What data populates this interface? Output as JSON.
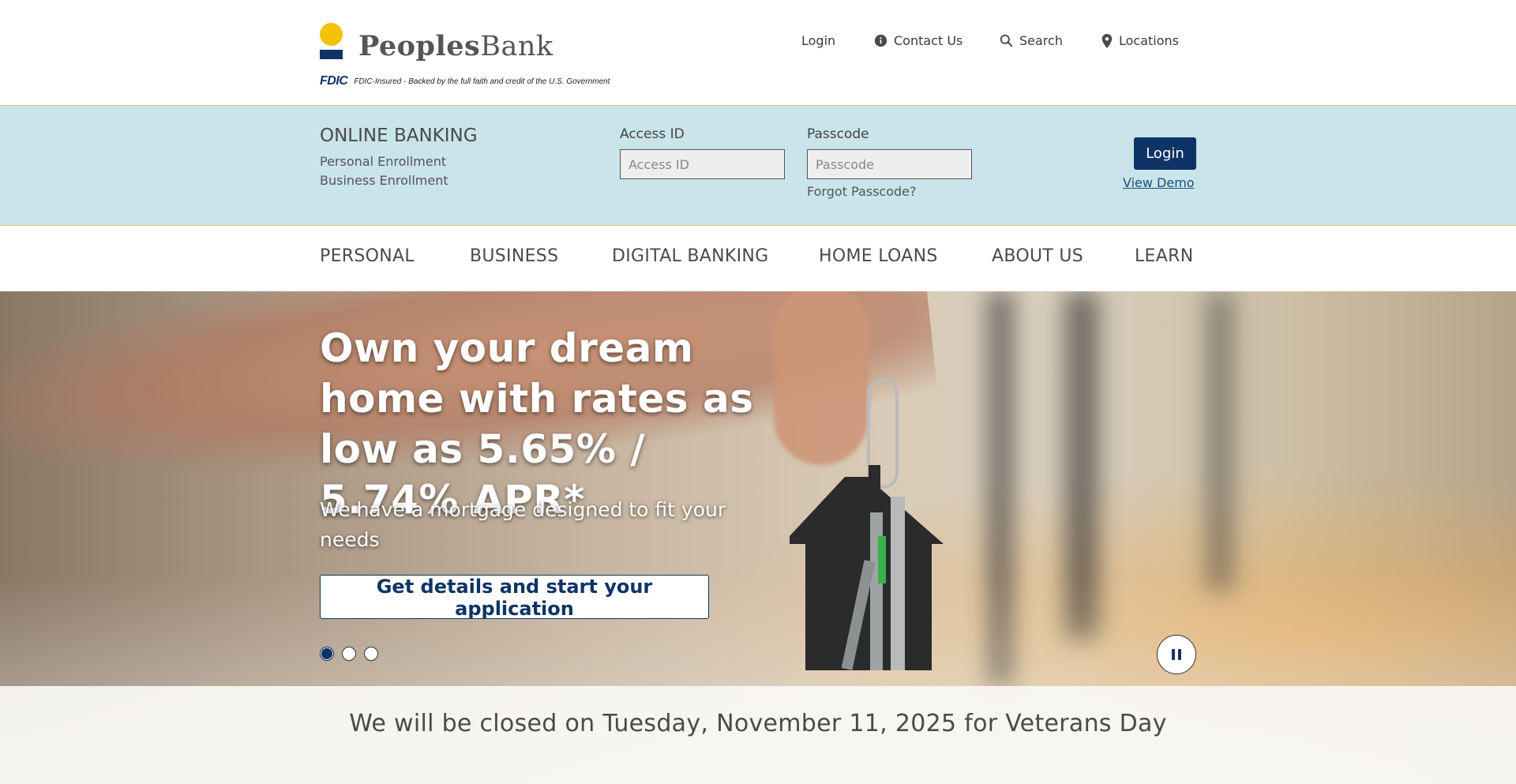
{
  "brand": {
    "name_bold": "Peoples",
    "name_light": "Bank",
    "fdic_mark": "FDIC",
    "fdic_text": "FDIC-Insured - Backed by the full faith and credit of the U.S. Government",
    "colors": {
      "navy": "#0e3466",
      "gold": "#f3c200",
      "band": "#c9e4ea"
    }
  },
  "utility_nav": [
    {
      "label": "Login",
      "icon": ""
    },
    {
      "label": "Contact Us",
      "icon": "info-icon"
    },
    {
      "label": "Search",
      "icon": "search-icon"
    },
    {
      "label": "Locations",
      "icon": "map-pin-icon"
    }
  ],
  "online_banking": {
    "title": "ONLINE BANKING",
    "personal_enrollment": "Personal Enrollment",
    "business_enrollment": "Business Enrollment",
    "access_id_label": "Access ID",
    "access_id_placeholder": "Access ID",
    "passcode_label": "Passcode",
    "passcode_placeholder": "Passcode",
    "forgot": "Forgot Passcode?",
    "login_button": "Login",
    "view_demo": "View Demo"
  },
  "main_nav": [
    "PERSONAL",
    "BUSINESS",
    "DIGITAL BANKING",
    "HOME LOANS",
    "ABOUT US",
    "LEARN"
  ],
  "hero": {
    "heading": "Own your dream home with rates as low as 5.65% / 5.74% APR*",
    "subheading": "We have a mortgage designed to fit your needs",
    "cta": "Get details and start your application",
    "slide_count": 3,
    "active_slide": 1
  },
  "alert": {
    "text": "We will be closed on Tuesday, November 11, 2025 for Veterans Day"
  }
}
